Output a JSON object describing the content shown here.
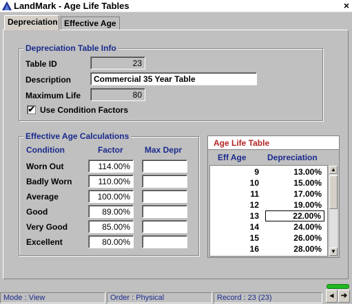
{
  "window": {
    "title": "LandMark - Age Life Tables",
    "close": "×"
  },
  "tabs": [
    {
      "label": "Depreciation",
      "active": true
    },
    {
      "label": "Effective Age",
      "active": false
    }
  ],
  "table_info": {
    "legend": "Depreciation Table Info",
    "table_id_label": "Table ID",
    "table_id": "23",
    "description_label": "Description",
    "description": "Commercial 35 Year Table",
    "max_life_label": "Maximum Life",
    "max_life": "80",
    "use_condition_label": "Use Condition Factors",
    "use_condition_checked": "✔"
  },
  "effective_age": {
    "legend": "Effective Age Calculations",
    "headers": {
      "condition": "Condition",
      "factor": "Factor",
      "max_depr": "Max Depr"
    },
    "rows": [
      {
        "condition": "Worn Out",
        "factor": "114.00%",
        "max_depr": ""
      },
      {
        "condition": "Badly Worn",
        "factor": "110.00%",
        "max_depr": ""
      },
      {
        "condition": "Average",
        "factor": "100.00%",
        "max_depr": ""
      },
      {
        "condition": "Good",
        "factor": "89.00%",
        "max_depr": ""
      },
      {
        "condition": "Very Good",
        "factor": "85.00%",
        "max_depr": ""
      },
      {
        "condition": "Excellent",
        "factor": "80.00%",
        "max_depr": ""
      }
    ]
  },
  "age_life": {
    "title": "Age Life Table",
    "headers": {
      "eff_age": "Eff Age",
      "depreciation": "Depreciation"
    },
    "rows": [
      {
        "age": "9",
        "dep": "13.00%"
      },
      {
        "age": "10",
        "dep": "15.00%"
      },
      {
        "age": "11",
        "dep": "17.00%"
      },
      {
        "age": "12",
        "dep": "19.00%"
      },
      {
        "age": "13",
        "dep": "22.00%",
        "selected": true
      },
      {
        "age": "14",
        "dep": "24.00%"
      },
      {
        "age": "15",
        "dep": "26.00%"
      },
      {
        "age": "16",
        "dep": "28.00%"
      }
    ]
  },
  "status": {
    "mode": "Mode : View",
    "order": "Order : Physical",
    "record": "Record : 23 (23)"
  },
  "icons": {
    "prev": "left-arrow-icon",
    "next": "right-arrow-icon",
    "app": "landmark-icon"
  },
  "colors": {
    "heading_blue": "#1a2a8c",
    "age_title_red": "#b22222",
    "progress_green": "#21b821"
  }
}
